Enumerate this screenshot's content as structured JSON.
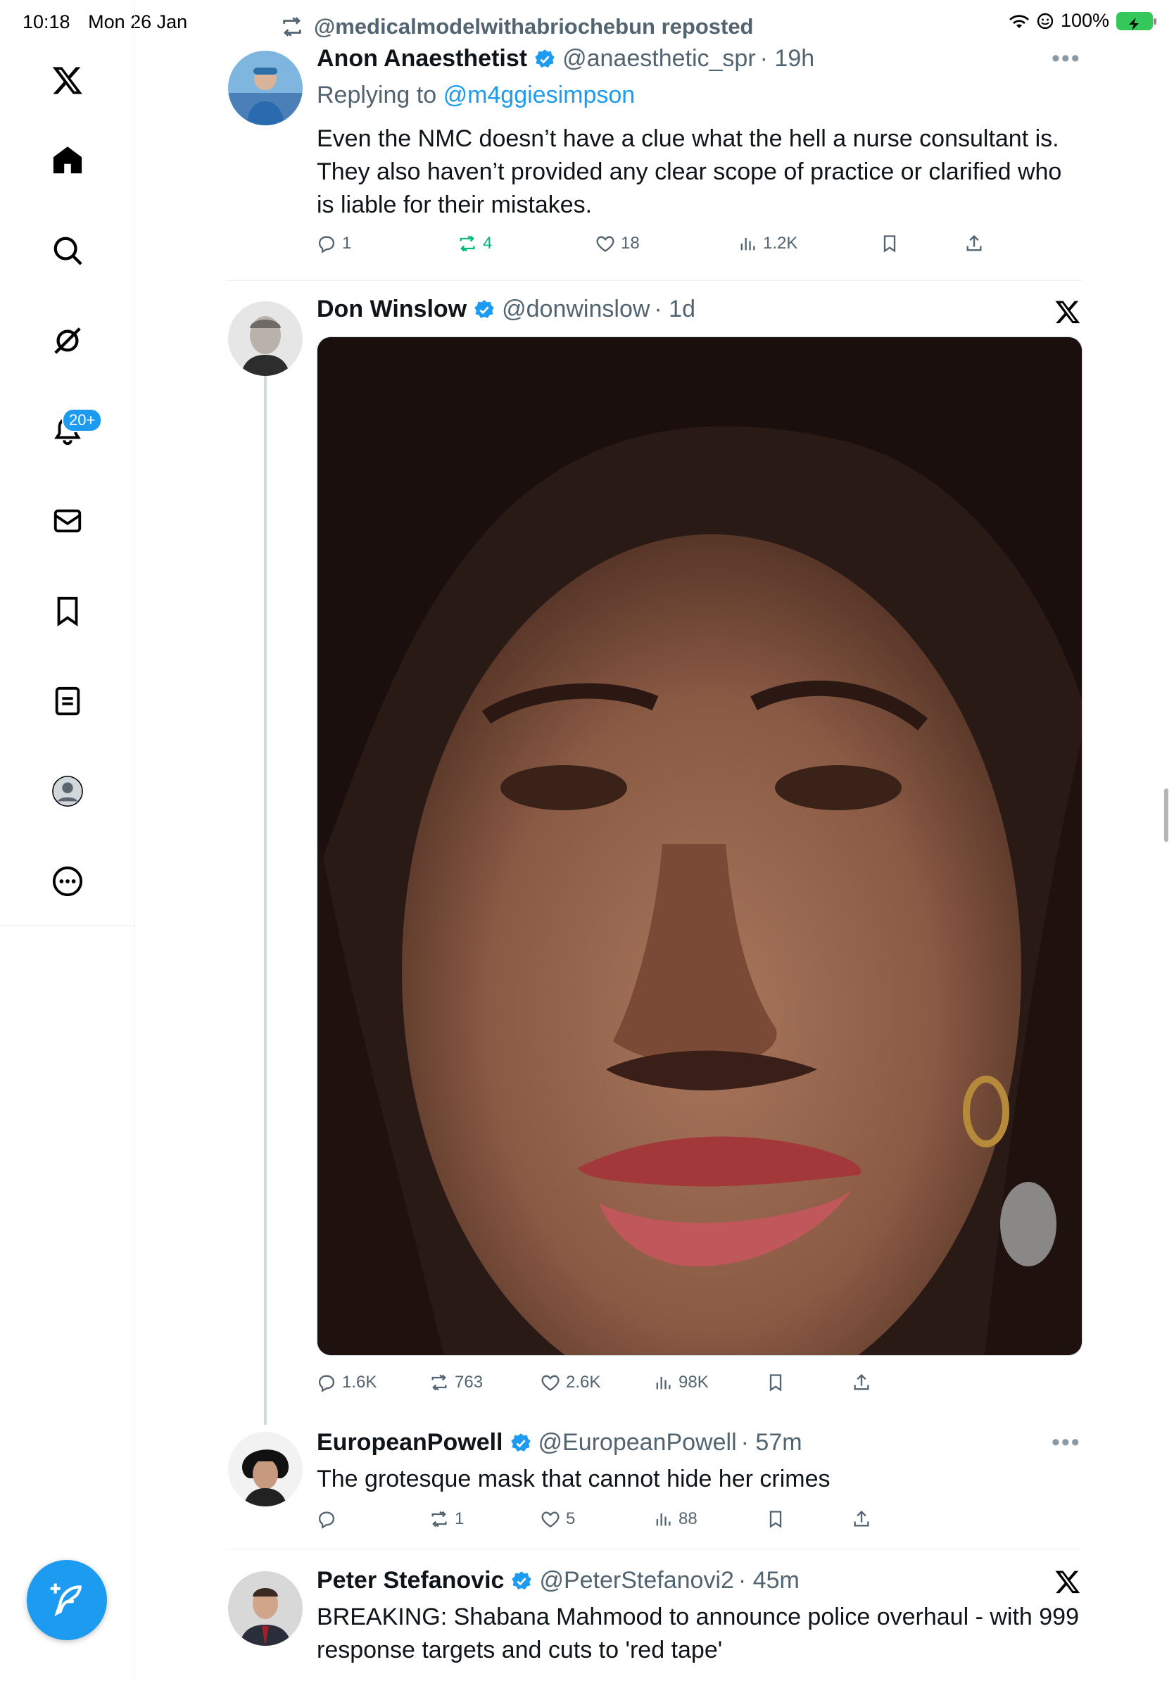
{
  "status": {
    "time": "10:18",
    "date": "Mon 26 Jan",
    "battery": "100%"
  },
  "sidebar": {
    "notifications_badge": "20+",
    "items": [
      "x-logo",
      "home",
      "search",
      "grok",
      "notifications",
      "messages",
      "bookmarks",
      "lists",
      "profile",
      "more"
    ]
  },
  "repost_banner": "@medicalmodelwithabriochebun reposted",
  "tweets": [
    {
      "name": "Anon Anaesthetist",
      "handle": "@anaesthetic_spr",
      "time": "· 19h",
      "replying_label": "Replying to",
      "replying_to": "@m4ggiesimpson",
      "text_lines": [
        "Even the NMC doesn’t have a clue what the hell a nurse consultant is.",
        "They also haven’t provided any clear scope of practice or clarified who",
        "is liable for their mistakes."
      ],
      "replies": "1",
      "reposts": "4",
      "likes": "18",
      "views": "1.2K"
    },
    {
      "name": "Don Winslow",
      "handle": "@donwinslow",
      "time": "· 1d",
      "replies": "1.6K",
      "reposts": "763",
      "likes": "2.6K",
      "views": "98K"
    },
    {
      "name": "EuropeanPowell",
      "handle": "@EuropeanPowell",
      "time": "· 57m",
      "text_lines": [
        "The grotesque mask that cannot hide her crimes"
      ],
      "replies": "",
      "reposts": "1",
      "likes": "5",
      "views": "88"
    },
    {
      "name": "Peter Stefanovic",
      "handle": "@PeterStefanovi2",
      "time": "· 45m",
      "text_lines": [
        "BREAKING: Shabana Mahmood to announce police overhaul - with 999",
        "response targets and cuts to 'red tape'"
      ]
    }
  ],
  "colors": {
    "accent": "#1d9bf0",
    "retweet_green": "#00ba7c",
    "muted": "#536471",
    "text": "#0f1419"
  }
}
